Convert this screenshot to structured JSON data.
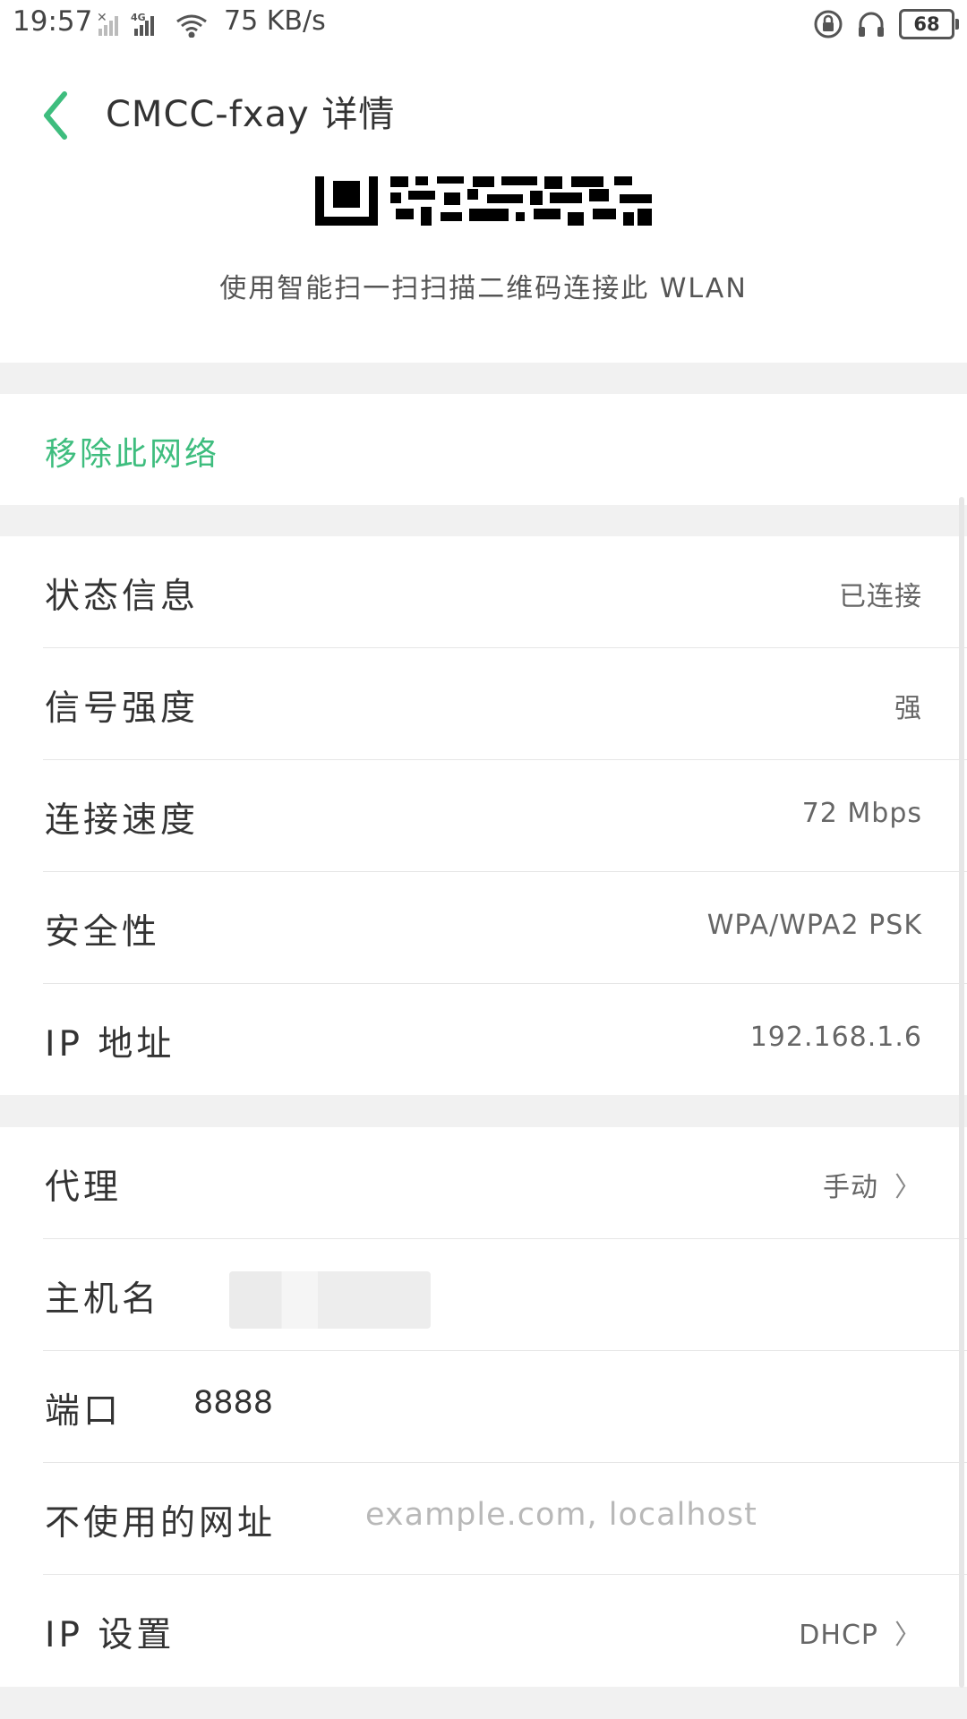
{
  "status_bar": {
    "time": "19:57",
    "network_type": "4G",
    "speed": "75 KB/s",
    "battery": "68",
    "icons": [
      "no-signal-icon",
      "signal-icon",
      "wifi-icon",
      "rotation-lock-icon",
      "headphones-icon",
      "battery-icon"
    ]
  },
  "header": {
    "back_icon": "chevron-left-icon",
    "title": "CMCC-fxay 详情"
  },
  "qr": {
    "caption": "使用智能扫一扫扫描二维码连接此 WLAN"
  },
  "remove_network": "移除此网络",
  "info": [
    {
      "label": "状态信息",
      "value": "已连接"
    },
    {
      "label": "信号强度",
      "value": "强"
    },
    {
      "label": "连接速度",
      "value": "72 Mbps"
    },
    {
      "label": "安全性",
      "value": "WPA/WPA2 PSK"
    },
    {
      "label": "IP 地址",
      "value": "192.168.1.6"
    }
  ],
  "proxy": {
    "label": "代理",
    "value": "手动",
    "hostname_label": "主机名",
    "port_label": "端口",
    "port_value": "8888",
    "bypass_label": "不使用的网址",
    "bypass_placeholder": "example.com, localhost",
    "ip_settings_label": "IP 设置",
    "ip_settings_value": "DHCP"
  },
  "colors": {
    "accent": "#3ebd7e",
    "gap": "#f1f1f1"
  }
}
